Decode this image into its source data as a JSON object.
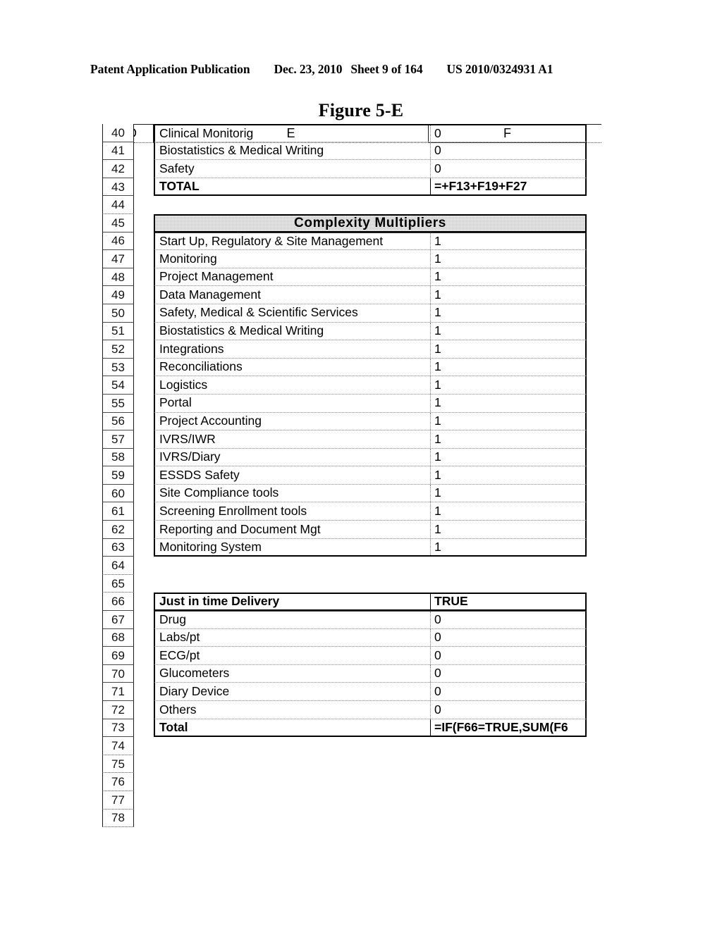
{
  "page_header": {
    "publication": "Patent Application Publication",
    "date": "Dec. 23, 2010",
    "sheet": "Sheet 9 of 164",
    "pub_number": "US 2010/0324931 A1"
  },
  "figure": {
    "title": "Figure 5-E"
  },
  "spreadsheet": {
    "column_headers": {
      "d": "D",
      "e": "E",
      "f": "F",
      "g": ""
    },
    "rows": [
      {
        "num": "40",
        "e": "Clinical Monitorig",
        "f": "0",
        "style": "normal"
      },
      {
        "num": "41",
        "e": "Biostatistics & Medical Writing",
        "f": "0",
        "style": "normal"
      },
      {
        "num": "42",
        "e": "Safety",
        "f": "0",
        "style": "normal"
      },
      {
        "num": "43",
        "e": "TOTAL",
        "f": "=+F13+F19+F27",
        "style": "bold-total"
      },
      {
        "num": "44",
        "e": "",
        "f": "",
        "style": "empty"
      },
      {
        "num": "45",
        "e": "Complexity Multipliers",
        "f": "",
        "style": "section-header"
      },
      {
        "num": "46",
        "e": "Start Up, Regulatory & Site Management",
        "f": "1",
        "style": "normal"
      },
      {
        "num": "47",
        "e": "Monitoring",
        "f": "1",
        "style": "normal"
      },
      {
        "num": "48",
        "e": "Project Management",
        "f": "1",
        "style": "normal"
      },
      {
        "num": "49",
        "e": "Data Management",
        "f": "1",
        "style": "normal"
      },
      {
        "num": "50",
        "e": "Safety, Medical & Scientific Services",
        "f": "1",
        "style": "normal"
      },
      {
        "num": "51",
        "e": "Biostatistics & Medical Writing",
        "f": "1",
        "style": "normal"
      },
      {
        "num": "52",
        "e": "Integrations",
        "f": "1",
        "style": "normal"
      },
      {
        "num": "53",
        "e": "Reconciliations",
        "f": "1",
        "style": "normal"
      },
      {
        "num": "54",
        "e": "Logistics",
        "f": "1",
        "style": "normal"
      },
      {
        "num": "55",
        "e": "Portal",
        "f": "1",
        "style": "normal"
      },
      {
        "num": "56",
        "e": "Project Accounting",
        "f": "1",
        "style": "normal"
      },
      {
        "num": "57",
        "e": "IVRS/IWR",
        "f": "1",
        "style": "normal"
      },
      {
        "num": "58",
        "e": "IVRS/Diary",
        "f": "1",
        "style": "normal"
      },
      {
        "num": "59",
        "e": "ESSDS Safety",
        "f": "1",
        "style": "normal"
      },
      {
        "num": "60",
        "e": "Site Compliance tools",
        "f": "1",
        "style": "normal"
      },
      {
        "num": "61",
        "e": "Screening Enrollment tools",
        "f": "1",
        "style": "normal"
      },
      {
        "num": "62",
        "e": "Reporting and Document Mgt",
        "f": "1",
        "style": "normal"
      },
      {
        "num": "63",
        "e": "Monitoring System",
        "f": "1",
        "style": "last-in-block"
      },
      {
        "num": "64",
        "e": "",
        "f": "",
        "style": "empty"
      },
      {
        "num": "65",
        "e": "",
        "f": "",
        "style": "empty"
      },
      {
        "num": "66",
        "e": "Just in time Delivery",
        "f": "TRUE",
        "style": "bold-header"
      },
      {
        "num": "67",
        "e": "Drug",
        "f": "0",
        "style": "normal"
      },
      {
        "num": "68",
        "e": "Labs/pt",
        "f": "0",
        "style": "normal"
      },
      {
        "num": "69",
        "e": "ECG/pt",
        "f": "0",
        "style": "normal"
      },
      {
        "num": "70",
        "e": "Glucometers",
        "f": "0",
        "style": "normal"
      },
      {
        "num": "71",
        "e": "Diary Device",
        "f": "0",
        "style": "normal"
      },
      {
        "num": "72",
        "e": "Others",
        "f": "0",
        "style": "normal"
      },
      {
        "num": "73",
        "e": "Total",
        "f": "=IF(F66=TRUE,SUM(F6",
        "style": "bold-total"
      },
      {
        "num": "74",
        "e": "",
        "f": "",
        "style": "empty"
      },
      {
        "num": "75",
        "e": "",
        "f": "",
        "style": "empty"
      },
      {
        "num": "76",
        "e": "",
        "f": "",
        "style": "empty"
      },
      {
        "num": "77",
        "e": "",
        "f": "",
        "style": "empty"
      },
      {
        "num": "78",
        "e": "",
        "f": "",
        "style": "empty"
      }
    ]
  }
}
